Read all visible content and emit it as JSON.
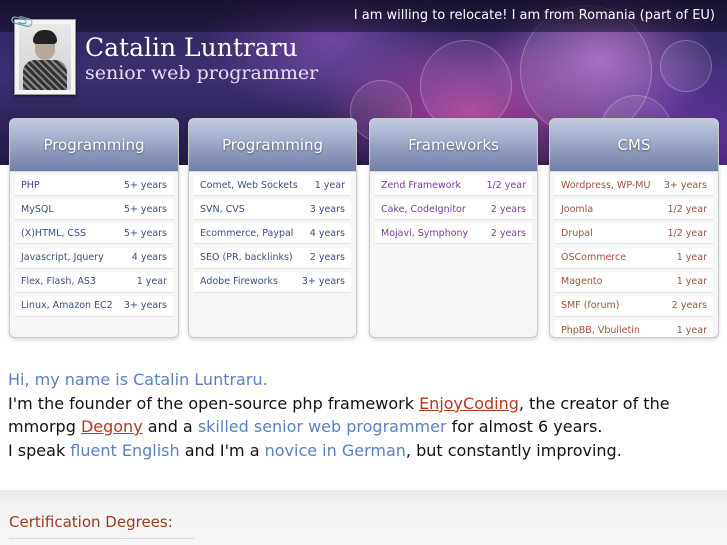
{
  "header": {
    "relocate_text": "I am willing to relocate! I am from Romania (part of EU)",
    "name": "Catalin Luntraru",
    "subtitle": "senior web programmer"
  },
  "panels": [
    {
      "title": "Programming",
      "rows": [
        {
          "skill": "PHP",
          "years": "5+ years"
        },
        {
          "skill": "MySQL",
          "years": "5+ years"
        },
        {
          "skill": "(X)HTML, CSS",
          "years": "5+ years"
        },
        {
          "skill": "Javascript, Jquery",
          "years": "4 years"
        },
        {
          "skill": "Flex, Flash, AS3",
          "years": "1 year"
        },
        {
          "skill": "Linux, Amazon EC2",
          "years": "3+ years"
        }
      ]
    },
    {
      "title": "Programming",
      "rows": [
        {
          "skill": "Comet, Web Sockets",
          "years": "1 year"
        },
        {
          "skill": "SVN, CVS",
          "years": "3 years"
        },
        {
          "skill": "Ecommerce, Paypal",
          "years": "4 years"
        },
        {
          "skill": "SEO (PR, backlinks)",
          "years": "2 years"
        },
        {
          "skill": "Adobe Fireworks",
          "years": "3+ years"
        }
      ]
    },
    {
      "title": "Frameworks",
      "rows": [
        {
          "skill": "Zend Framework",
          "years": "1/2 year"
        },
        {
          "skill": "Cake, CodeIgnitor",
          "years": "2 years"
        },
        {
          "skill": "Mojavi, Symphony",
          "years": "2 years"
        }
      ]
    },
    {
      "title": "CMS",
      "rows": [
        {
          "skill": "Wordpress, WP-MU",
          "years": "3+ years"
        },
        {
          "skill": "Joomla",
          "years": "1/2 year"
        },
        {
          "skill": "Drupal",
          "years": "1/2 year"
        },
        {
          "skill": "OSCommerce",
          "years": "1 year"
        },
        {
          "skill": "Magento",
          "years": "1 year"
        },
        {
          "skill": "SMF (forum)",
          "years": "2 years"
        },
        {
          "skill": "PhpBB, Vbulletin",
          "years": "1 year"
        }
      ]
    }
  ],
  "intro": {
    "greeting": "Hi, my name is Catalin Luntraru.",
    "line2_pre": "I'm the founder of the open-source php framework ",
    "framework_link": "EnjoyCoding",
    "line2_mid": ", the creator of the mmorpg ",
    "game_link": "Degony",
    "line2_and": " and a ",
    "skilled_text": "skilled senior web programmer",
    "line2_post": " for almost 6 years.",
    "line3_pre": "I speak ",
    "english_text": "fluent English",
    "line3_mid": " and I'm a ",
    "german_text": "novice in German",
    "line3_post": ", but constantly improving."
  },
  "certifications": {
    "title": "Certification Degrees:"
  },
  "icons": {
    "paperclip": "paperclip-icon"
  },
  "colors": {
    "link": "#b33a1f",
    "highlight": "#5a80c4",
    "cert_title": "#9a3a1e"
  }
}
